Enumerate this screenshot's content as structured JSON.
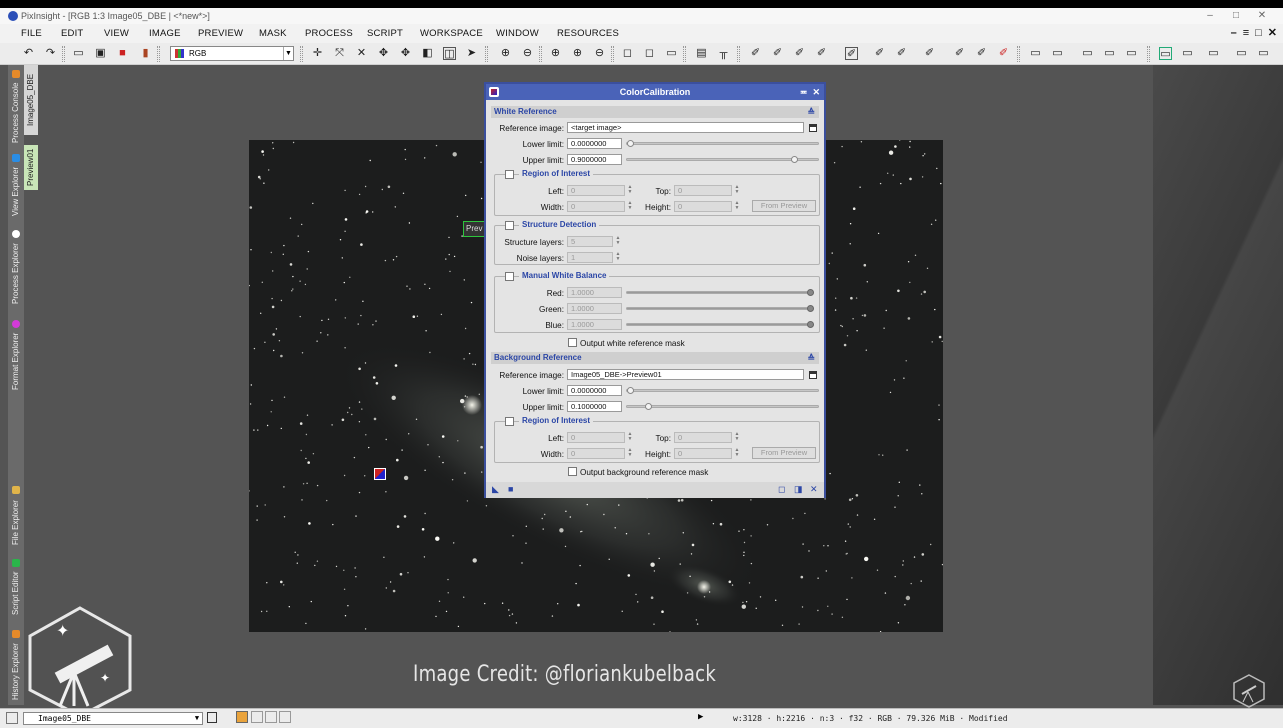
{
  "window": {
    "title": "PixInsight - [RGB 1:3 Image05_DBE | <*new*>]",
    "controls": [
      "–",
      "□",
      "✕"
    ]
  },
  "menu": {
    "items": [
      "FILE",
      "EDIT",
      "VIEW",
      "IMAGE",
      "PREVIEW",
      "MASK",
      "PROCESS",
      "SCRIPT",
      "WORKSPACE",
      "WINDOW",
      "RESOURCES"
    ],
    "mdi_controls": [
      "–",
      "≡",
      "□",
      "✕"
    ]
  },
  "toolbar": {
    "view_mode": "RGB"
  },
  "side_panel": {
    "tabs": [
      "Process Console",
      "View Explorer",
      "Process Explorer",
      "Format Explorer",
      "File Explorer",
      "Script Editor",
      "History Explorer"
    ],
    "image_tabs": [
      "Image05_DBE",
      "Preview01"
    ]
  },
  "preview_label": "Prev",
  "dialog": {
    "title": "ColorCalibration",
    "white_reference": {
      "section_label": "White Reference",
      "reference_image_label": "Reference image:",
      "reference_image_value": "<target image>",
      "lower_limit_label": "Lower limit:",
      "lower_limit_value": "0.0000000",
      "lower_limit_fraction": 0.0,
      "upper_limit_label": "Upper limit:",
      "upper_limit_value": "0.9000000",
      "upper_limit_fraction": 0.9,
      "roi": {
        "title": "Region of Interest",
        "left_label": "Left:",
        "left_value": "0",
        "top_label": "Top:",
        "top_value": "0",
        "width_label": "Width:",
        "width_value": "0",
        "height_label": "Height:",
        "height_value": "0",
        "from_preview": "From Preview"
      },
      "structure_detection": {
        "title": "Structure Detection",
        "structure_layers_label": "Structure layers:",
        "structure_layers_value": "5",
        "noise_layers_label": "Noise layers:",
        "noise_layers_value": "1"
      },
      "manual_white_balance": {
        "title": "Manual White Balance",
        "red_label": "Red:",
        "red_value": "1.0000",
        "green_label": "Green:",
        "green_value": "1.0000",
        "blue_label": "Blue:",
        "blue_value": "1.0000"
      },
      "output_mask_label": "Output white reference mask"
    },
    "background_reference": {
      "section_label": "Background Reference",
      "reference_image_label": "Reference image:",
      "reference_image_value": "Image05_DBE->Preview01",
      "lower_limit_label": "Lower limit:",
      "lower_limit_value": "0.0000000",
      "lower_limit_fraction": 0.0,
      "upper_limit_label": "Upper limit:",
      "upper_limit_value": "0.1000000",
      "upper_limit_fraction": 0.1,
      "roi": {
        "title": "Region of Interest",
        "left_label": "Left:",
        "left_value": "0",
        "top_label": "Top:",
        "top_value": "0",
        "width_label": "Width:",
        "width_value": "0",
        "height_label": "Height:",
        "height_value": "0",
        "from_preview": "From Preview"
      },
      "output_mask_label": "Output background reference mask"
    }
  },
  "credit": "Image Credit: @floriankubelback",
  "status_bar": {
    "image_name": "Image05_DBE",
    "info": "w:3128 · h:2216 · n:3 · f32 · RGB · 79.326 MiB · Modified"
  }
}
